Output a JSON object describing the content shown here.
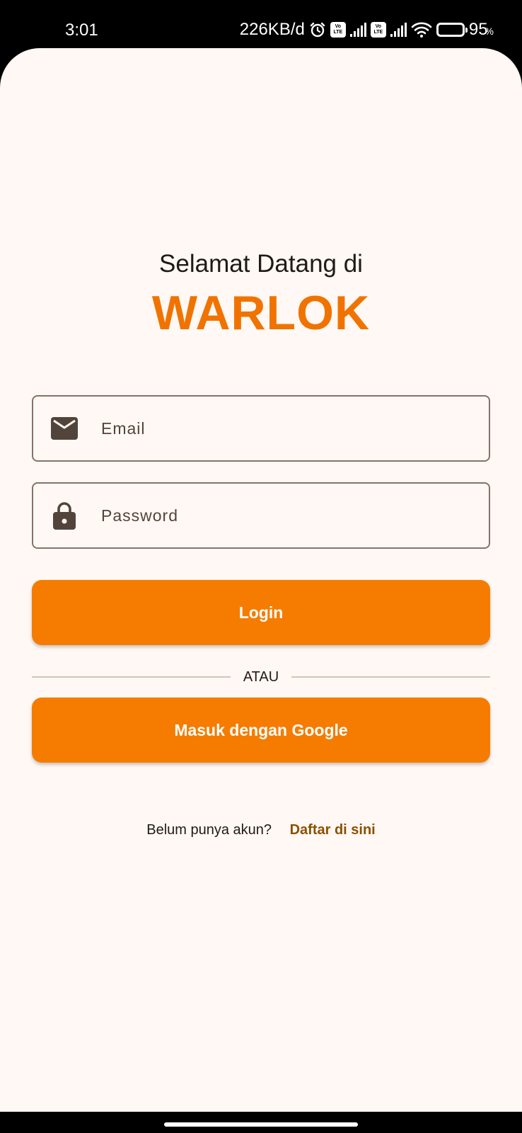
{
  "status_bar": {
    "time": "3:01",
    "net_speed": "226KB/d",
    "volte_top": "Vo",
    "volte_bottom": "LTE",
    "battery_level": "95",
    "battery_unit": "%"
  },
  "header": {
    "welcome": "Selamat Datang di",
    "brand": "WARLOK"
  },
  "form": {
    "email_placeholder": "Email",
    "email_value": "",
    "password_placeholder": "Password",
    "password_value": ""
  },
  "buttons": {
    "login": "Login",
    "divider": "ATAU",
    "google": "Masuk dengan Google"
  },
  "footer": {
    "question": "Belum punya akun?",
    "register_link": "Daftar di sini"
  },
  "icons": {
    "email": "mail-icon",
    "password": "lock-icon"
  },
  "colors": {
    "accent": "#f57c00",
    "brand": "#f07300",
    "link": "#8b5000",
    "background": "#fff8f4"
  }
}
